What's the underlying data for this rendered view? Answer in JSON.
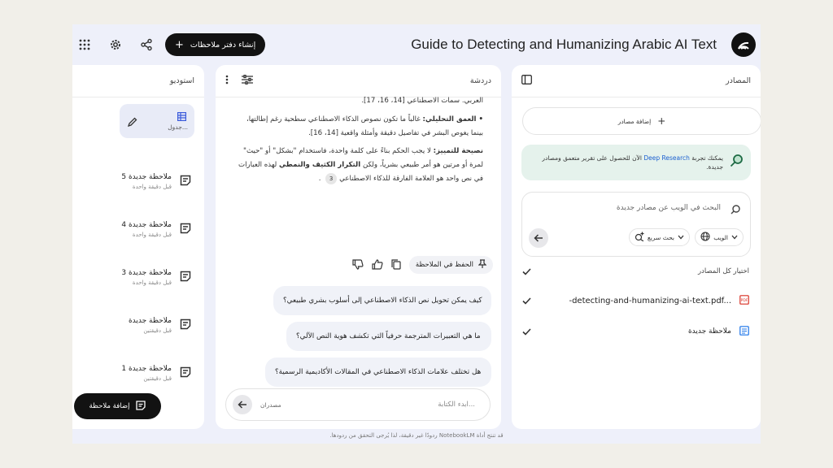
{
  "app": {
    "title": "Guide to Detecting and Humanizing Arabic AI Text",
    "create_notebook_label": "إنشاء دفتر ملاحظات"
  },
  "studio": {
    "header": "استوديو",
    "card_label": "جدول...",
    "notes": [
      {
        "title": "ملاحظة جديدة 5",
        "time": "قبل دقيقة واحدة"
      },
      {
        "title": "ملاحظة جديدة 4",
        "time": "قبل دقيقة واحدة"
      },
      {
        "title": "ملاحظة جديدة 3",
        "time": "قبل دقيقة واحدة"
      },
      {
        "title": "ملاحظة جديدة",
        "time": "قبل دقيقتين"
      },
      {
        "title": "ملاحظة جديدة 1",
        "time": "قبل دقيقتين"
      }
    ],
    "add_note_label": "إضافة ملاحظة"
  },
  "chat": {
    "header": "دردشة",
    "p0": "العربي. سمات الاصطناعي [14، 16، 17].",
    "p1_bold": "• العمق التحليلي:",
    "p1_text": " غالباً ما تكون نصوص الذكاء الاصطناعي سطحية رغم إطالتها، بينما يغوص البشر في تفاصيل دقيقة وأمثلة واقعية [14، 16].",
    "p2_bold": "نصيحة للتمييز:",
    "p2_text_a": " لا يجب الحكم بناءً على كلمة واحدة، فاستخدام \"بشكل\" أو \"حيث\" لمرة أو مرتين هو أمر طبيعي بشرياً، ولكن ",
    "p2_bold2": "التكرار الكثيف والنمطي",
    "p2_text_b": " لهذه العبارات في نص واحد هو العلامة الفارقة للذكاء الاصطناعي",
    "citation": "3",
    "save_to_note": "الحفظ في الملاحظة",
    "suggestions": [
      "كيف يمكن تحويل نص الذكاء الاصطناعي إلى أسلوب بشري طبيعي؟",
      "ما هي التعبيرات المترجمة حرفياً التي تكشف هوية النص الآلي؟",
      "هل تختلف علامات الذكاء الاصطناعي في المقالات الأكاديمية الرسمية؟"
    ],
    "input_placeholder": "ابدء الكتابة...",
    "sources_count": "مصدران"
  },
  "sources": {
    "header": "المصادر",
    "add_source": "إضافة مصادر",
    "deep_pre": "يمكنك تجربة ",
    "deep_link": "Deep Research",
    "deep_post": " الآن للحصول على تقرير متعمق ومصادر جديدة.",
    "search_placeholder": "البحث في الويب عن مصادر جديدة",
    "web_label": "الويب",
    "fast_search_label": "بحث سريع",
    "select_all": "اختيار كل المصادر",
    "items": [
      {
        "name": "-detecting-and-humanizing-ai-text.pdf...",
        "type": "pdf"
      },
      {
        "name": "ملاحظة جديدة",
        "type": "note"
      }
    ]
  },
  "footer": "قد تنتج أداة NotebookLM ردودًا غير دقيقة، لذا يُرجى التحقق من ردودها.",
  "colors": {
    "accent_dark": "#121212",
    "deep_bg": "#e5f2ec",
    "link": "#1a5fd0",
    "pdf_red": "#d93025",
    "note_blue": "#1a73e8"
  }
}
